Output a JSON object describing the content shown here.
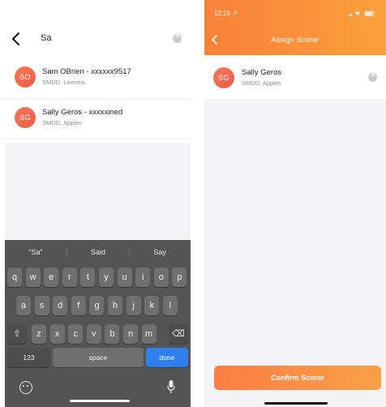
{
  "left": {
    "search": {
      "query": "Sa"
    },
    "results": [
      {
        "initials": "SO",
        "title": "Sam OBrien - xxxxxx9517",
        "subtitle": "SMDD, Lemons"
      },
      {
        "initials": "SG",
        "title": "Sally  Geros - xxxxxined",
        "subtitle": "SMDD, Apples"
      }
    ],
    "keyboard": {
      "suggestions": [
        "“Sa”",
        "Said",
        "Say"
      ],
      "row1": [
        "q",
        "w",
        "e",
        "r",
        "t",
        "y",
        "u",
        "i",
        "o",
        "p"
      ],
      "row2": [
        "a",
        "s",
        "d",
        "f",
        "g",
        "h",
        "j",
        "k",
        "l"
      ],
      "row3": [
        "z",
        "x",
        "c",
        "v",
        "b",
        "n",
        "m"
      ],
      "shift_glyph": "⇧",
      "delete_glyph": "⌫",
      "numbers_label": "123",
      "space_label": "space",
      "done_label": "done"
    }
  },
  "right": {
    "status": {
      "time": "12:15 ↗"
    },
    "header_title": "Assign Scorer",
    "selected": {
      "initials": "SG",
      "name": "Sally  Geros",
      "subtitle": "SMDD, Apples"
    },
    "confirm_label": "Confirm Scorer"
  }
}
